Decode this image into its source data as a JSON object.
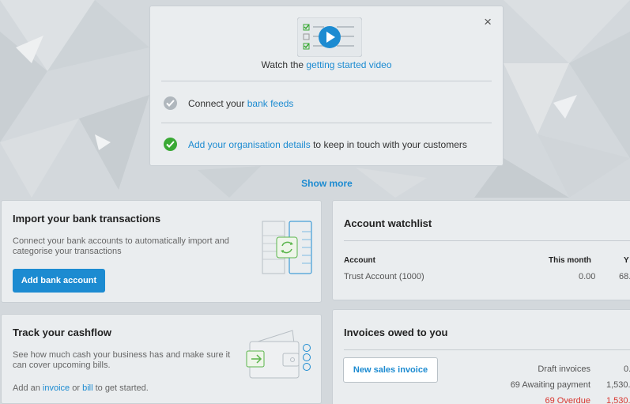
{
  "getting_started": {
    "close_label": "×",
    "watch_prefix": "Watch the ",
    "watch_link": "getting started video",
    "bank_feeds_prefix": "Connect your ",
    "bank_feeds_link": "bank feeds",
    "org_link": "Add your organisation details",
    "org_suffix": " to keep in touch with your customers"
  },
  "show_more": "Show more",
  "import_bank": {
    "title": "Import your bank transactions",
    "description": "Connect your bank accounts to automatically import and categorise your transactions",
    "button": "Add bank account"
  },
  "cashflow": {
    "title": "Track your cashflow",
    "description": "See how much cash your business has and make sure it can cover upcoming bills.",
    "add_prefix": "Add an ",
    "invoice_link": "invoice",
    "or_text": " or ",
    "bill_link": "bill",
    "add_suffix": " to get started."
  },
  "watchlist": {
    "title": "Account watchlist",
    "col_account": "Account",
    "col_this_month": "This month",
    "col_ytd": "Y",
    "rows": [
      {
        "account": "Trust Account (1000)",
        "this_month": "0.00",
        "ytd": "68."
      }
    ]
  },
  "invoices": {
    "title": "Invoices owed to you",
    "button": "New sales invoice",
    "rows": [
      {
        "label": "Draft invoices",
        "amount": "0.",
        "status": "normal"
      },
      {
        "label": "69 Awaiting payment",
        "amount": "1,530.",
        "status": "normal"
      },
      {
        "label": "69 Overdue",
        "amount": "1,530.",
        "status": "overdue"
      }
    ]
  },
  "colors": {
    "accent": "#1c8bd1",
    "success": "#3aa935",
    "pending": "#b0b7bd",
    "overdue": "#d9352e"
  },
  "icons": {
    "video": "video-play-icon",
    "close": "close-icon",
    "bank_step": "check-circle-grey-icon",
    "org_step": "check-circle-green-icon",
    "bank_sync": "bank-sync-icon",
    "wallet": "wallet-icon"
  }
}
